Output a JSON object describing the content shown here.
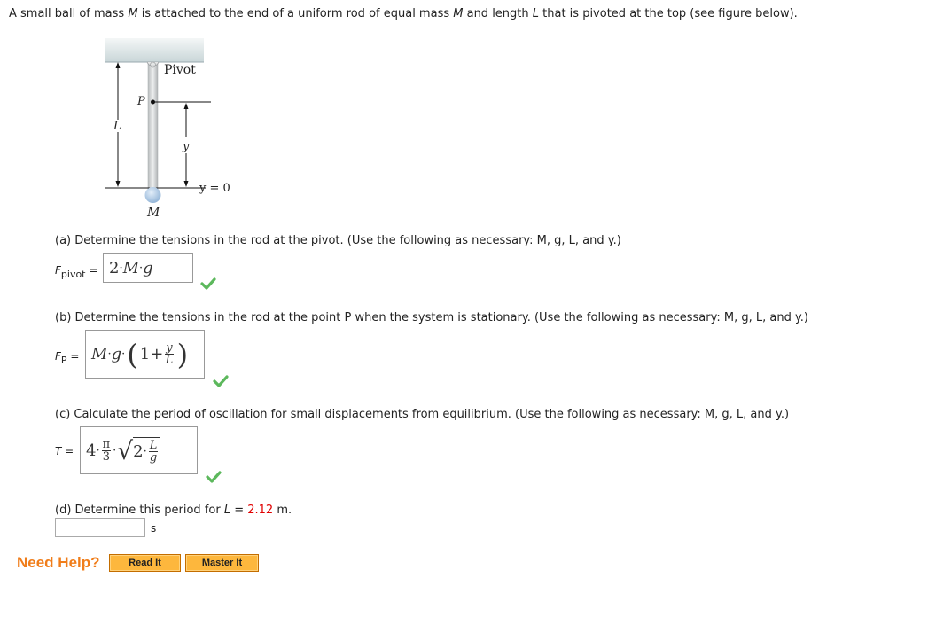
{
  "intro": {
    "p1": "A small ball of mass ",
    "m1": "M",
    "p2": " is attached to the end of a uniform rod of equal mass ",
    "m2": "M",
    "p3": " and length ",
    "l1": "L",
    "p4": " that is pivoted at the top (see figure below)."
  },
  "figure": {
    "pivot_label": "Pivot",
    "point_label": "P",
    "length_label": "L",
    "y_label": "y",
    "y_zero_label": "y = 0",
    "mass_label": "M"
  },
  "parts": {
    "a": {
      "question": "(a) Determine the tensions in the rod at the pivot. (Use the following as necessary: M, g, L, and y.)",
      "label_main": "F",
      "label_sub": "pivot",
      "label_eq": " =",
      "answer": {
        "coef": "2",
        "dot1": "·",
        "M": "M",
        "dot2": "·",
        "g": "g"
      },
      "status": "correct"
    },
    "b": {
      "question": "(b) Determine the tensions in the rod at the point P when the system is stationary. (Use the following as necessary: M, g, L, and y.)",
      "label_main": "F",
      "label_sub": "P",
      "label_eq": " =",
      "answer": {
        "M": "M",
        "dot1": "·",
        "g": "g",
        "dot2": "·",
        "lparen": "(",
        "one": "1",
        "plus": " + ",
        "num": "y",
        "den": "L",
        "rparen": ")"
      },
      "status": "correct"
    },
    "c": {
      "question": "(c) Calculate the period of oscillation for small displacements from equilibrium. (Use the following as necessary: M, g, L, and y.)",
      "label_main": "T",
      "label_eq": " =",
      "answer": {
        "coef": "4",
        "dot1": "·",
        "num": "π",
        "den": "3",
        "dot2": "·",
        "sqrt": "√",
        "two": "2",
        "dot3": "·",
        "rnum": "L",
        "rden": "g"
      },
      "status": "correct"
    },
    "d": {
      "question_pre": "(d) Determine this period for ",
      "question_var": "L",
      "question_eq": " = ",
      "question_value": "2.12",
      "question_unit": " m.",
      "input_value": "",
      "unit": "s"
    }
  },
  "help": {
    "label": "Need Help?",
    "read_it": "Read It",
    "master_it": "Master It"
  },
  "colors": {
    "accent_orange": "#f07d1a",
    "button_fill": "#fdb73d",
    "check_green": "#5cb85c",
    "value_red": "#e00000"
  }
}
